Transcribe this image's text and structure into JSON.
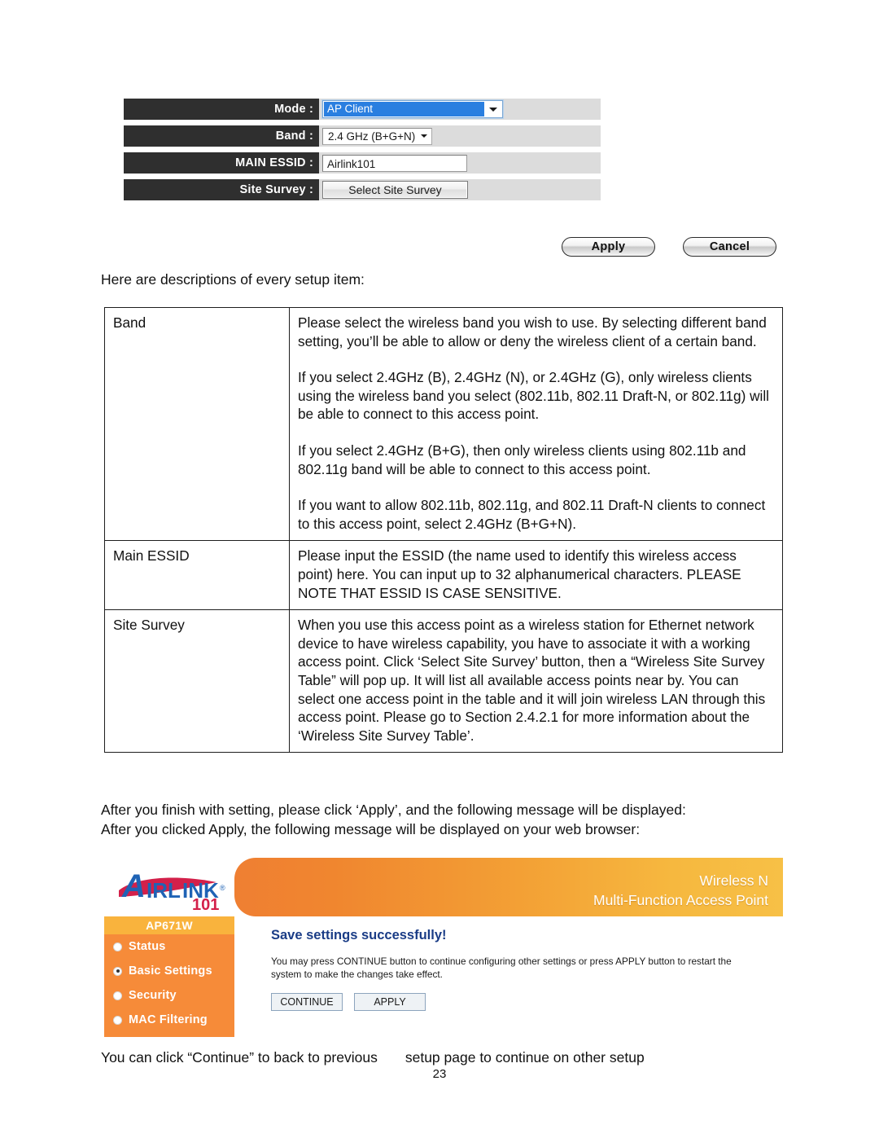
{
  "config_form": {
    "rows": [
      {
        "label": "Mode :",
        "control": "select",
        "value": "AP Client"
      },
      {
        "label": "Band :",
        "control": "select",
        "value": "2.4 GHz (B+G+N)"
      },
      {
        "label": "MAIN ESSID :",
        "control": "text",
        "value": "Airlink101"
      },
      {
        "label": "Site Survey :",
        "control": "button",
        "value": "Select Site Survey"
      }
    ]
  },
  "actions": {
    "apply_label": "Apply",
    "cancel_label": "Cancel"
  },
  "intro": "Here are descriptions of every setup item:",
  "description_table": {
    "rows": [
      {
        "term": "Band",
        "paragraphs": [
          "Please select the wireless band you wish to use. By selecting different band setting, you’ll be able to allow or deny the wireless client of a certain band.",
          "If you select 2.4GHz (B), 2.4GHz (N), or 2.4GHz (G), only wireless clients using the wireless band you select (802.11b, 802.11 Draft-N, or 802.11g) will be able to connect to this access point.",
          "If you select 2.4GHz (B+G), then only wireless clients using 802.11b and 802.11g band will be able to connect to this access point.",
          "If you want to allow 802.11b, 802.11g, and 802.11 Draft-N clients to connect to this access point, select 2.4GHz (B+G+N)."
        ]
      },
      {
        "term": "Main ESSID",
        "paragraphs": [
          "Please input the ESSID (the name used to identify this wireless access point) here. You can input up to 32 alphanumerical characters. PLEASE NOTE   THAT ESSID IS CASE SENSITIVE."
        ]
      },
      {
        "term": "Site Survey",
        "paragraphs": [
          "When you use this access point as a wireless station for Ethernet network device to have wireless capability, you have to associate it with a working access point. Click ‘Select Site Survey’ button, then a “Wireless Site Survey Table” will pop up. It will list all available access points near by. You can select one access point in the table and it will join wireless LAN through this access point. Please go to Section 2.4.2.1 for more information about the ‘Wireless Site Survey Table’."
        ]
      }
    ]
  },
  "after_text": {
    "line1": "After you finish with setting, please click ‘Apply’, and the following message will be displayed:",
    "line2": "After you clicked Apply, the following message will be displayed on your web browser:"
  },
  "ui_shot": {
    "brand": {
      "name_a": "A",
      "name_rest": "IRLINK",
      "registered": "®",
      "number": "101"
    },
    "banner": {
      "title_line1": "Wireless N",
      "title_line2": "Multi-Function Access Point"
    },
    "sidebar": {
      "model": "AP671W",
      "items": [
        {
          "label": "Status",
          "selected": false
        },
        {
          "label": "Basic Settings",
          "selected": true
        },
        {
          "label": "Security",
          "selected": false
        },
        {
          "label": "MAC Filtering",
          "selected": false
        }
      ]
    },
    "content": {
      "title": "Save settings successfully!",
      "message": "You may press CONTINUE button to continue configuring other settings or press APPLY button to restart the system to make the changes take effect.",
      "continue_label": "CONTINUE",
      "apply_label": "APPLY"
    }
  },
  "bottom_line": "You can click “Continue” to back to previous       setup page to continue on other setup",
  "page_number": "23",
  "colors": {
    "banner_start": "#ef7f32",
    "banner_end": "#f7c046",
    "sidebar": "#f68b39",
    "model_bar": "#f9b33d",
    "save_title": "#1a3c86",
    "select_highlight": "#2a7fe0",
    "label_bar": "#2f2f2f"
  }
}
